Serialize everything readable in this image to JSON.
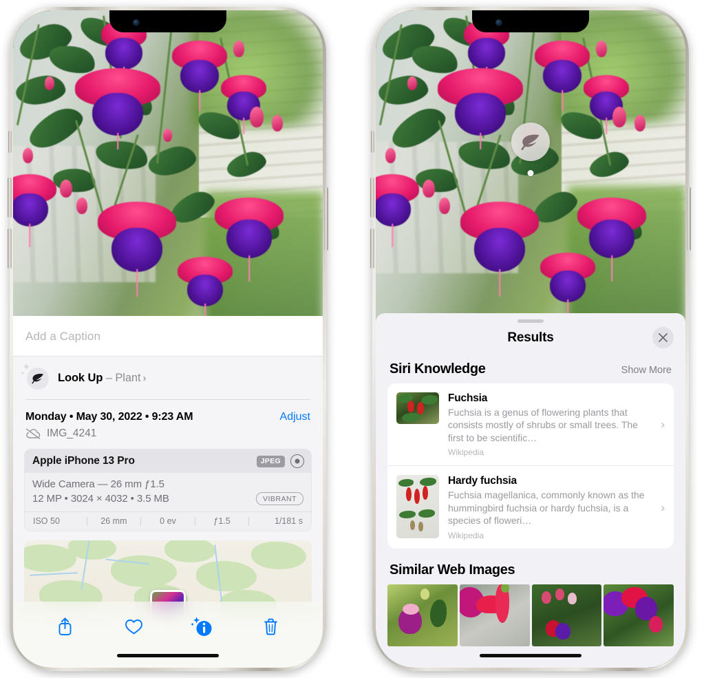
{
  "left_phone": {
    "caption": {
      "placeholder": "Add a Caption",
      "value": ""
    },
    "lookup": {
      "icon": "leaf-icon",
      "label": "Look Up",
      "dash": " – ",
      "subject": "Plant",
      "chevron": "›"
    },
    "meta": {
      "date_line": "Monday • May 30, 2022 • 9:23 AM",
      "adjust_label": "Adjust",
      "cloud_icon": "cloud-slash-icon",
      "filename": "IMG_4241"
    },
    "camera": {
      "model": "Apple iPhone 13 Pro",
      "format_badge": "JPEG",
      "raw_icon": "raw-circle-icon",
      "lens_line": "Wide Camera — 26 mm ƒ1.5",
      "size_line": "12 MP  •  3024 × 4032  •  3.5 MB",
      "style_badge": "VIBRANT",
      "exif": [
        "ISO 50",
        "26 mm",
        "0 ev",
        "ƒ1.5",
        "1/181 s"
      ]
    },
    "map": {
      "pin_label": "photo-pin"
    },
    "toolbar": [
      {
        "name": "share-button",
        "icon": "share-icon"
      },
      {
        "name": "favorite-button",
        "icon": "heart-icon"
      },
      {
        "name": "info-button",
        "icon": "info-sparkle-icon"
      },
      {
        "name": "delete-button",
        "icon": "trash-icon"
      }
    ]
  },
  "right_phone": {
    "visual_lookup_badge": {
      "icon": "leaf-icon"
    },
    "sheet": {
      "title": "Results",
      "close_icon": "close-icon",
      "siri_section": {
        "title": "Siri Knowledge",
        "show_more": "Show More",
        "items": [
          {
            "title": "Fuchsia",
            "description": "Fuchsia is a genus of flowering plants that consists mostly of shrubs or small trees. The first to be scientific…",
            "source": "Wikipedia",
            "chevron": "›"
          },
          {
            "title": "Hardy fuchsia",
            "description": "Fuchsia magellanica, commonly known as the hummingbird fuchsia or hardy fuchsia, is a species of floweri…",
            "source": "Wikipedia",
            "chevron": "›"
          }
        ]
      },
      "web_section": {
        "title": "Similar Web Images",
        "thumbnails": [
          "web-image-1",
          "web-image-2",
          "web-image-3",
          "web-image-4"
        ]
      }
    }
  },
  "colors": {
    "accent_blue": "#027aff",
    "panel_bg": "#f5f5f7",
    "sheet_bg": "#f2f1f6",
    "card_bg": "#ffffff",
    "secondary_text": "#8e8e93",
    "tertiary_text": "#b6b6bd"
  }
}
